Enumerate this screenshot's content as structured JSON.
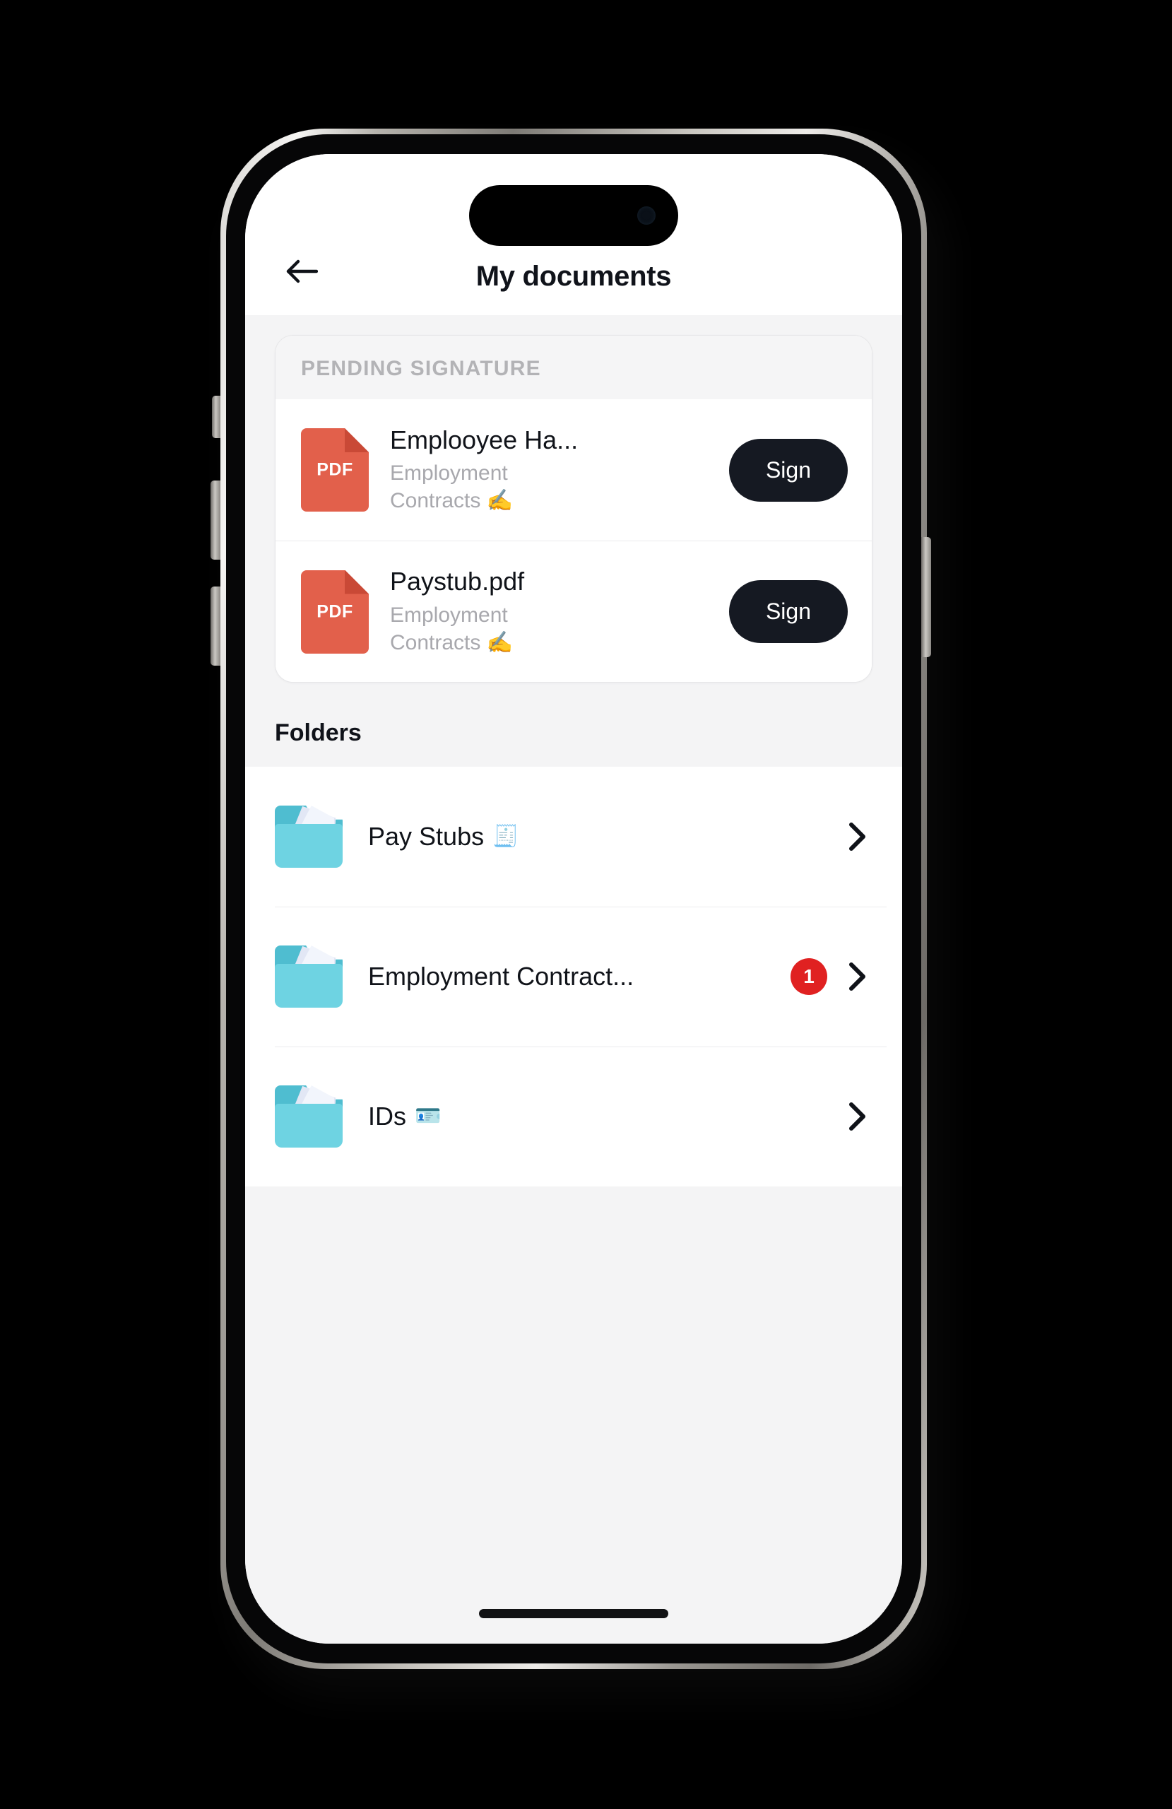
{
  "app": {
    "title": "My documents",
    "back_icon": "arrow-left-icon"
  },
  "pending": {
    "section_label": "PENDING SIGNATURE",
    "documents": [
      {
        "file_type": "PDF",
        "name": "Emplooyee Ha...",
        "subtitle": "Employment Contracts ✍️",
        "action_label": "Sign"
      },
      {
        "file_type": "PDF",
        "name": "Paystub.pdf",
        "subtitle": "Employment Contracts ✍️",
        "action_label": "Sign"
      }
    ]
  },
  "folders": {
    "section_title": "Folders",
    "items": [
      {
        "label": "Pay Stubs",
        "emoji": "🧾",
        "badge": ""
      },
      {
        "label": "Employment Contract...",
        "emoji": "",
        "badge": "1"
      },
      {
        "label": "IDs",
        "emoji": "🪪",
        "badge": ""
      }
    ]
  },
  "colors": {
    "pdf_red": "#e2604b",
    "folder_cyan": "#6ed3e2",
    "badge_red": "#e02121",
    "sign_button": "#151922",
    "screen_bg": "#f4f4f5"
  }
}
